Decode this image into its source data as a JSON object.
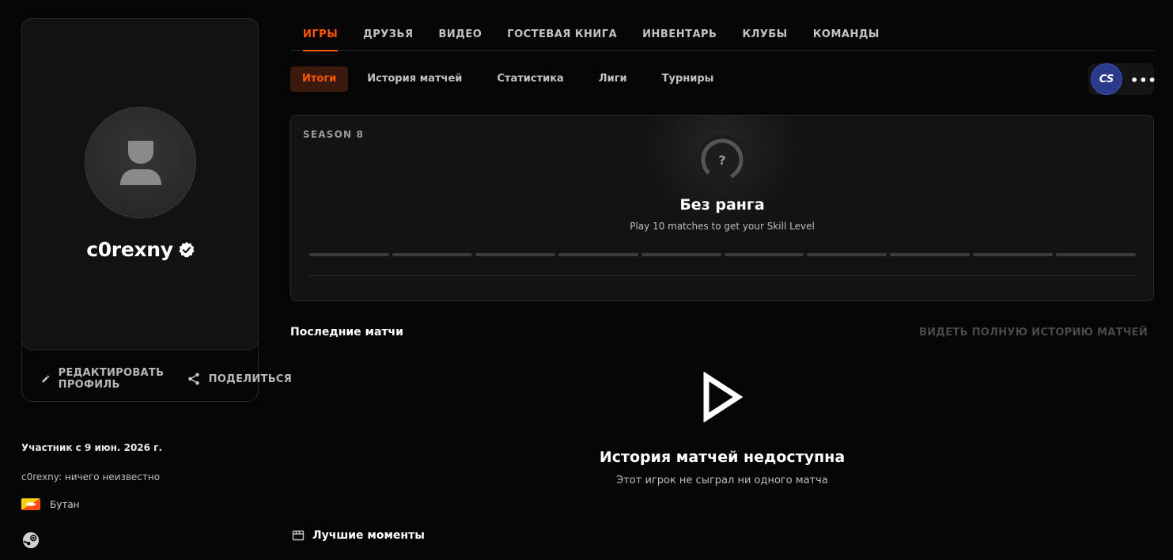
{
  "profile": {
    "username": "c0rexny",
    "edit_label": "РЕДАКТИРОВАТЬ ПРОФИЛЬ",
    "share_label": "ПОДЕЛИТЬСЯ",
    "joined": "Участник с 9 июн. 2026 г.",
    "bio": "c0rexny: ничего неизвестно",
    "country": "Бутан"
  },
  "main_tabs": [
    {
      "label": "ИГРЫ",
      "active": true
    },
    {
      "label": "ДРУЗЬЯ"
    },
    {
      "label": "ВИДЕО"
    },
    {
      "label": "ГОСТЕВАЯ КНИГА"
    },
    {
      "label": "ИНВЕНТАРЬ"
    },
    {
      "label": "КЛУБЫ"
    },
    {
      "label": "КОМАНДЫ"
    }
  ],
  "sub_tabs": [
    {
      "label": "Итоги",
      "active": true
    },
    {
      "label": "История матчей"
    },
    {
      "label": "Статистика"
    },
    {
      "label": "Лиги"
    },
    {
      "label": "Турниры"
    }
  ],
  "game_switch": {
    "game_label": "CS",
    "more": "•••"
  },
  "rank": {
    "season": "SEASON 8",
    "icon_symbol": "?",
    "title": "Без ранга",
    "subtitle": "Play 10 matches to get your Skill Level",
    "levels_filled": 0,
    "levels_total": 10
  },
  "recent": {
    "title": "Последние матчи",
    "full_history": "ВИДЕТЬ ПОЛНУЮ ИСТОРИЮ МАТЧЕЙ",
    "empty_title": "История матчей недоступна",
    "empty_sub": "Этот игрок не сыграл ни одного матча"
  },
  "highlights": {
    "title": "Лучшие моменты"
  },
  "colors": {
    "accent": "#ff5500",
    "background": "#060606",
    "card": "#131313"
  }
}
